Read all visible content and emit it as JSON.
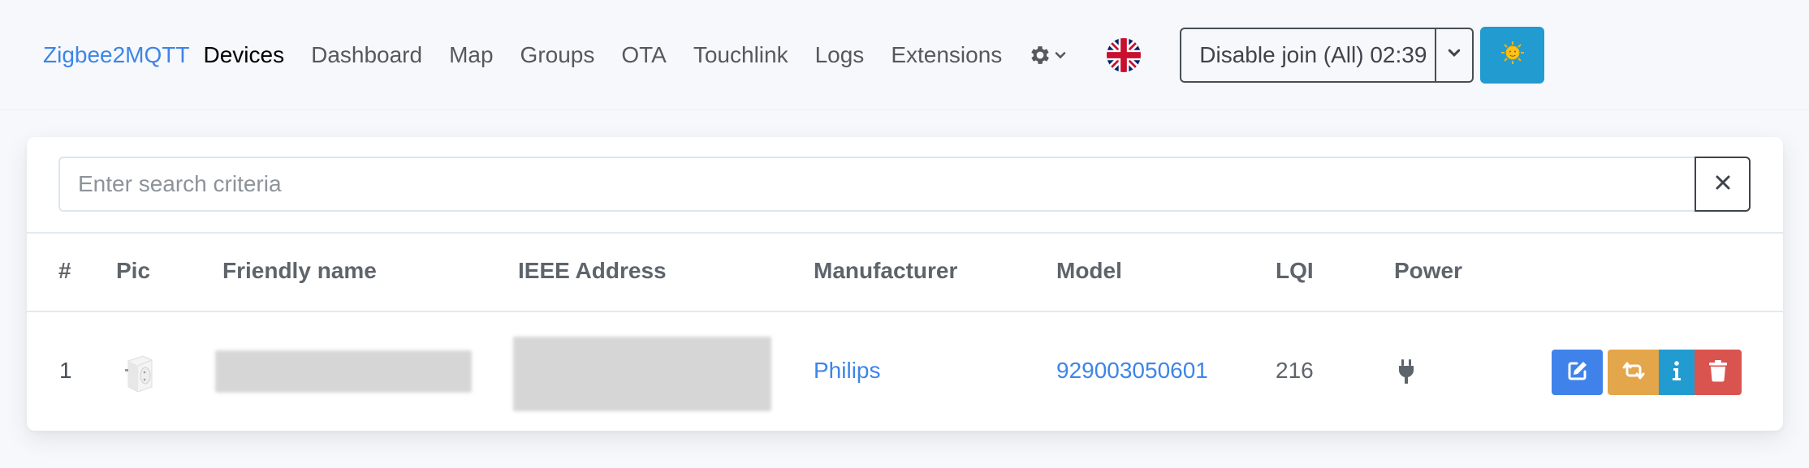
{
  "navbar": {
    "brand": "Zigbee2MQTT",
    "links": [
      {
        "label": "Devices",
        "active": true
      },
      {
        "label": "Dashboard",
        "active": false
      },
      {
        "label": "Map",
        "active": false
      },
      {
        "label": "Groups",
        "active": false
      },
      {
        "label": "OTA",
        "active": false
      },
      {
        "label": "Touchlink",
        "active": false
      },
      {
        "label": "Logs",
        "active": false
      },
      {
        "label": "Extensions",
        "active": false
      }
    ],
    "settings_icon": "gear-icon",
    "language_icon": "uk-flag-icon",
    "join_button_label": "Disable join (All) 02:39",
    "theme_icon": "sun-icon"
  },
  "search": {
    "placeholder": "Enter search criteria",
    "value": "",
    "clear_icon": "close-icon"
  },
  "table": {
    "headers": [
      "#",
      "Pic",
      "Friendly name",
      "IEEE Address",
      "Manufacturer",
      "Model",
      "LQI",
      "Power"
    ],
    "rows": [
      {
        "index": "1",
        "pic": "smart-plug-image",
        "friendly_name": "[redacted]",
        "ieee_address": "[redacted]",
        "manufacturer": "Philips",
        "model": "929003050601",
        "lqi": "216",
        "power": "plug-icon",
        "actions": [
          "edit-icon",
          "rename-icon",
          "info-icon",
          "trash-icon"
        ]
      }
    ]
  },
  "colors": {
    "brand": "#3d85e8",
    "link": "#3d85e8",
    "edit": "#3f82ea",
    "rename": "#e3a64a",
    "info": "#229bd0",
    "delete": "#d9534f",
    "theme_button": "#229bd0"
  }
}
